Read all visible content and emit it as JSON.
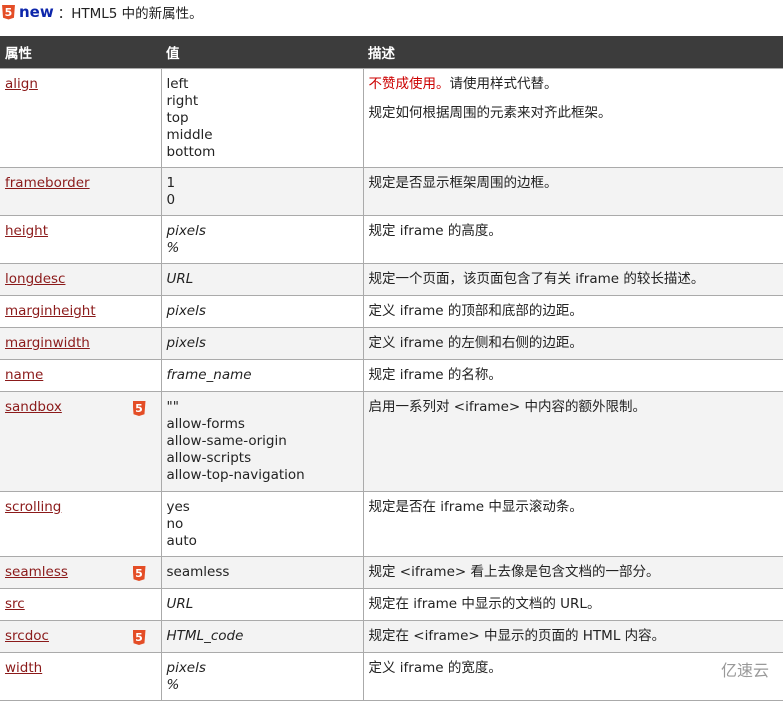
{
  "header": {
    "badge_icon": "html5-icon",
    "new_label": "new",
    "new_text": "：HTML5 中的新属性。"
  },
  "table": {
    "columns": [
      "属性",
      "值",
      "描述"
    ],
    "rows": [
      {
        "attr": "align",
        "html5": false,
        "values": [
          "left",
          "right",
          "top",
          "middle",
          "bottom"
        ],
        "italic": false,
        "desc_deprecated": "不赞成使用。",
        "desc_deprecated_tail": "请使用样式代替。",
        "desc": "规定如何根据周围的元素来对齐此框架。"
      },
      {
        "attr": "frameborder",
        "html5": false,
        "values": [
          "1",
          "0"
        ],
        "italic": false,
        "desc": "规定是否显示框架周围的边框。"
      },
      {
        "attr": "height",
        "html5": false,
        "values": [
          "pixels",
          "%"
        ],
        "italic": true,
        "desc": "规定 iframe 的高度。"
      },
      {
        "attr": "longdesc",
        "html5": false,
        "values": [
          "URL"
        ],
        "italic": true,
        "desc": "规定一个页面，该页面包含了有关 iframe 的较长描述。"
      },
      {
        "attr": "marginheight",
        "html5": false,
        "values": [
          "pixels"
        ],
        "italic": true,
        "desc": "定义 iframe 的顶部和底部的边距。"
      },
      {
        "attr": "marginwidth",
        "html5": false,
        "values": [
          "pixels"
        ],
        "italic": true,
        "desc": "定义 iframe 的左侧和右侧的边距。"
      },
      {
        "attr": "name",
        "html5": false,
        "values": [
          "frame_name"
        ],
        "italic": true,
        "desc": "规定 iframe 的名称。"
      },
      {
        "attr": "sandbox",
        "html5": true,
        "values": [
          "\"\"",
          "allow-forms",
          "allow-same-origin",
          "allow-scripts",
          "allow-top-navigation"
        ],
        "italic": false,
        "desc": "启用一系列对 <iframe> 中内容的额外限制。"
      },
      {
        "attr": "scrolling",
        "html5": false,
        "values": [
          "yes",
          "no",
          "auto"
        ],
        "italic": false,
        "desc": "规定是否在 iframe 中显示滚动条。"
      },
      {
        "attr": "seamless",
        "html5": true,
        "values": [
          "seamless"
        ],
        "italic": false,
        "desc": "规定 <iframe> 看上去像是包含文档的一部分。"
      },
      {
        "attr": "src",
        "html5": false,
        "values": [
          "URL"
        ],
        "italic": true,
        "desc": "规定在 iframe 中显示的文档的 URL。"
      },
      {
        "attr": "srcdoc",
        "html5": true,
        "values": [
          "HTML_code"
        ],
        "italic": true,
        "desc": "规定在 <iframe> 中显示的页面的 HTML 内容。"
      },
      {
        "attr": "width",
        "html5": false,
        "values": [
          "pixels",
          "%"
        ],
        "italic": true,
        "desc": "定义 iframe 的宽度。"
      }
    ]
  },
  "watermark": "亿速云",
  "html5_badge_text": "5",
  "colors": {
    "header_bg": "#3c3c3c",
    "link": "#8b1a1a",
    "deprecated": "#cc0000",
    "html5_badge": "#e44d26",
    "new_label": "#0d26ab"
  }
}
